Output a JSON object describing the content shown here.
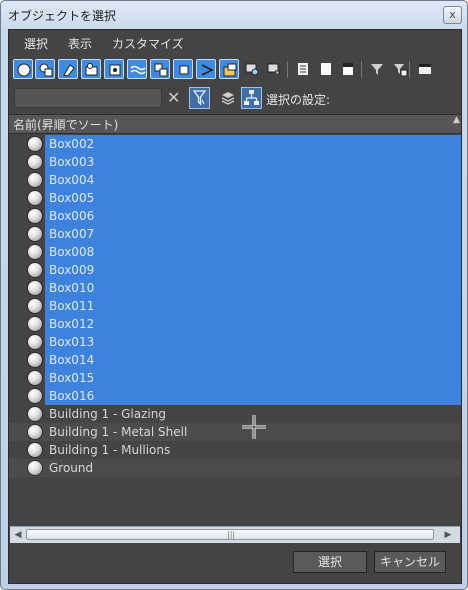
{
  "window": {
    "title": "オブジェクトを選択",
    "close_glyph": "x"
  },
  "menu": [
    "選択",
    "表示",
    "カスタマイズ"
  ],
  "toolbar": {
    "icons": [
      {
        "name": "geometry-filter-icon",
        "on": true
      },
      {
        "name": "shapes-filter-icon",
        "on": true
      },
      {
        "name": "lights-filter-icon",
        "on": true
      },
      {
        "name": "cameras-filter-icon",
        "on": true
      },
      {
        "name": "helpers-filter-icon",
        "on": true
      },
      {
        "name": "space-warps-filter-icon",
        "on": true
      },
      {
        "name": "groups-filter-icon",
        "on": true
      },
      {
        "name": "xrefs-filter-icon",
        "on": true
      },
      {
        "name": "bones-filter-icon",
        "on": true
      },
      {
        "name": "containers-filter-icon",
        "on": true
      },
      {
        "name": "frozen-filter-icon",
        "on": false
      },
      {
        "name": "hidden-filter-icon",
        "on": false
      },
      {
        "name": "list-all-icon",
        "on": false
      },
      {
        "name": "list-none-icon",
        "on": false
      },
      {
        "name": "list-invert-icon",
        "on": false
      },
      {
        "name": "filter-icon",
        "on": false
      },
      {
        "name": "filter-settings-icon",
        "on": false
      },
      {
        "name": "collapse-icon",
        "on": false
      }
    ]
  },
  "filter": {
    "search_value": "",
    "search_placeholder": "",
    "clear_glyph": "✕",
    "selection_settings_label": "選択の設定:"
  },
  "list": {
    "column_header": "名前(昇順でソート)",
    "sort_glyph": "▲",
    "rows": [
      {
        "name": "Box002",
        "selected": true
      },
      {
        "name": "Box003",
        "selected": true
      },
      {
        "name": "Box004",
        "selected": true
      },
      {
        "name": "Box005",
        "selected": true
      },
      {
        "name": "Box006",
        "selected": true
      },
      {
        "name": "Box007",
        "selected": true
      },
      {
        "name": "Box008",
        "selected": true
      },
      {
        "name": "Box009",
        "selected": true
      },
      {
        "name": "Box010",
        "selected": true
      },
      {
        "name": "Box011",
        "selected": true
      },
      {
        "name": "Box012",
        "selected": true
      },
      {
        "name": "Box013",
        "selected": true
      },
      {
        "name": "Box014",
        "selected": true
      },
      {
        "name": "Box015",
        "selected": true
      },
      {
        "name": "Box016",
        "selected": true
      },
      {
        "name": "Building 1 - Glazing",
        "selected": false
      },
      {
        "name": "Building 1 - Metal Shell",
        "selected": false
      },
      {
        "name": "Building 1 - Mullions",
        "selected": false
      },
      {
        "name": "Ground",
        "selected": false
      }
    ]
  },
  "scrollbar": {
    "left_glyph": "◀",
    "right_glyph": "▶",
    "grip_glyph": "|||"
  },
  "buttons": {
    "select": "選択",
    "cancel": "キャンセル"
  },
  "colors": {
    "selection": "#3d83de",
    "panel": "#444444",
    "toolbar_active": "#3d8be3"
  }
}
